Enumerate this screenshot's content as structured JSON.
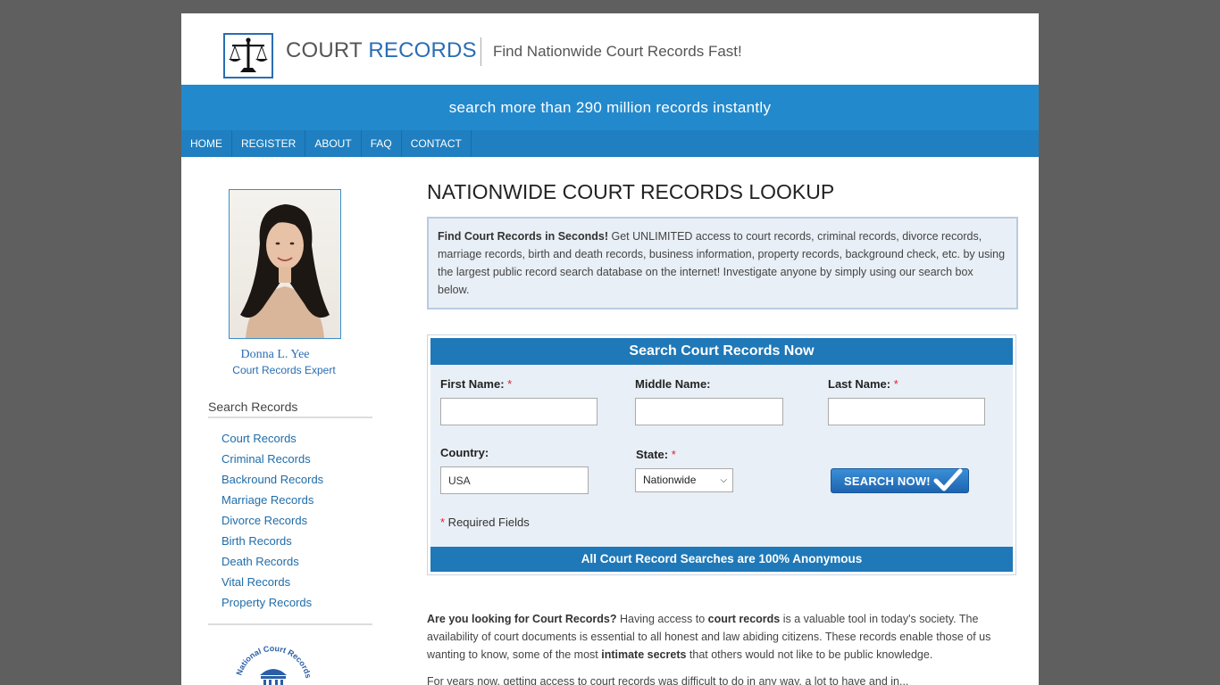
{
  "header": {
    "logo_word1": "COURT",
    "logo_word2": "RECORDS",
    "tagline": "Find Nationwide Court Records Fast!",
    "banner": "search more than 290 million records instantly"
  },
  "nav": {
    "items": [
      "HOME",
      "REGISTER",
      "ABOUT",
      "FAQ",
      "CONTACT"
    ]
  },
  "sidebar": {
    "expert_name": "Donna L. Yee",
    "expert_title": "Court Records Expert",
    "heading": "Search Records",
    "links": [
      "Court Records",
      "Criminal Records",
      "Backround Records",
      "Marriage Records",
      "Divorce Records",
      "Birth Records",
      "Death Records",
      "Vital Records",
      "Property Records"
    ],
    "seal_text": "National Court Records"
  },
  "main": {
    "title": "NATIONWIDE COURT RECORDS LOOKUP",
    "intro_bold": "Find Court Records in Seconds!",
    "intro_text": " Get UNLIMITED access to court records, criminal records, divorce records, marriage records, birth and death records, business information, property records, background check, etc. by using the largest public record search database on the internet! Investigate anyone by simply using our search box below.",
    "body_q_bold": "Are you looking for Court Records?",
    "body_p1": " Having access to ",
    "body_bold1": "court records",
    "body_p2": " is a valuable tool in today's society. The availability of court documents is essential to all honest and law abiding citizens. These records enable those of us wanting to know, some of the most ",
    "body_bold2": "intimate secrets",
    "body_p3": " that others would not like to be public knowledge.",
    "body_text2": "For years now, getting access to court records was difficult to do in any way, a lot to have and in..."
  },
  "search": {
    "heading": "Search Court Records Now",
    "first_name_label": "First Name:",
    "middle_name_label": "Middle Name:",
    "last_name_label": "Last Name:",
    "country_label": "Country:",
    "country_value": "USA",
    "state_label": "State:",
    "state_value": "Nationwide",
    "required_marker": "*",
    "button_label": "SEARCH NOW!",
    "required_note": " Required Fields",
    "footer": "All Court Record Searches are 100% Anonymous"
  },
  "colors": {
    "brand_blue": "#2389cd",
    "nav_blue": "#1f7fc0",
    "box_bg": "#e9eff6",
    "required_red": "#dd2233"
  }
}
